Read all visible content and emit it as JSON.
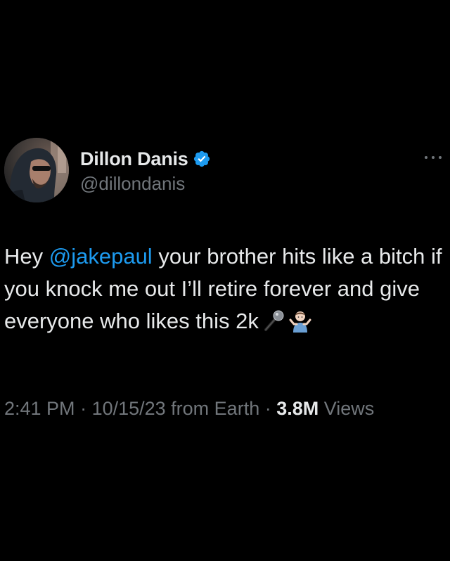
{
  "author": {
    "display_name": "Dillon Danis",
    "handle": "@dillondanis",
    "verified": true,
    "verified_color": "#1d9bf0",
    "avatar_icon": "profile-photo-hooded-man"
  },
  "tweet": {
    "text_prefix": "Hey ",
    "mention": "@jakepaul",
    "text_line_rest": " your brother hits like a bitch if you knock me out I’ll retire forever and give everyone who likes this 2k",
    "emojis": [
      "microphone-emoji",
      "man-shrugging-emoji"
    ]
  },
  "meta": {
    "time": "2:41 PM",
    "sep1": " · ",
    "date": "10/15/23",
    "source": " from Earth",
    "sep2": " · ",
    "views_count": "3.8M",
    "views_label": " Views"
  },
  "menu": {
    "more_icon": "more-horizontal-icon"
  },
  "colors": {
    "background": "#000000",
    "text_primary": "#e7e9ea",
    "text_secondary": "#71767b",
    "link": "#1d9bf0"
  }
}
